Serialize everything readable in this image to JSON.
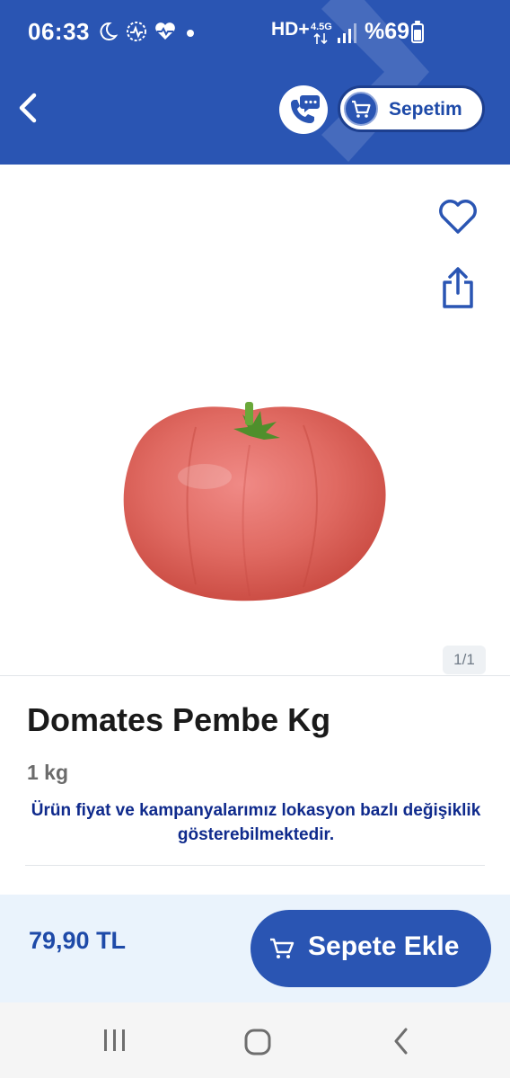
{
  "status_bar": {
    "time": "06:33",
    "network_label": "HD+",
    "network_type": "4.5G",
    "battery_text": "%69",
    "battery_level": 0.69,
    "icons": [
      "moon-icon",
      "health-monitor-icon",
      "heart-rate-icon",
      "notification-dot-icon",
      "volte-icon",
      "data-arrows-icon",
      "signal-icon",
      "battery-icon"
    ]
  },
  "header": {
    "cart_label": "Sepetim",
    "icons": [
      "back-arrow-icon",
      "phone-chat-icon",
      "cart-icon",
      "brand-watermark-icon"
    ]
  },
  "gallery": {
    "pager": "1/1",
    "icons": [
      "heart-icon",
      "share-icon"
    ],
    "image_subject": "tomato"
  },
  "product": {
    "title": "Domates Pembe Kg",
    "unit": "1 kg",
    "notice": "Ürün fiyat ve kampanyalarımız lokasyon bazlı değişiklik gösterebilmektedir."
  },
  "purchase": {
    "price": "79,90 TL",
    "add_label": "Sepete Ekle",
    "icons": [
      "cart-icon"
    ]
  },
  "nav": {
    "icons": [
      "recents-icon",
      "home-icon",
      "back-icon"
    ]
  },
  "colors": {
    "brand_blue": "#2a55b3",
    "dark_blue": "#1e4aa8",
    "notice_blue": "#0f2a8c",
    "buy_bar_bg": "#eaf3fc"
  }
}
